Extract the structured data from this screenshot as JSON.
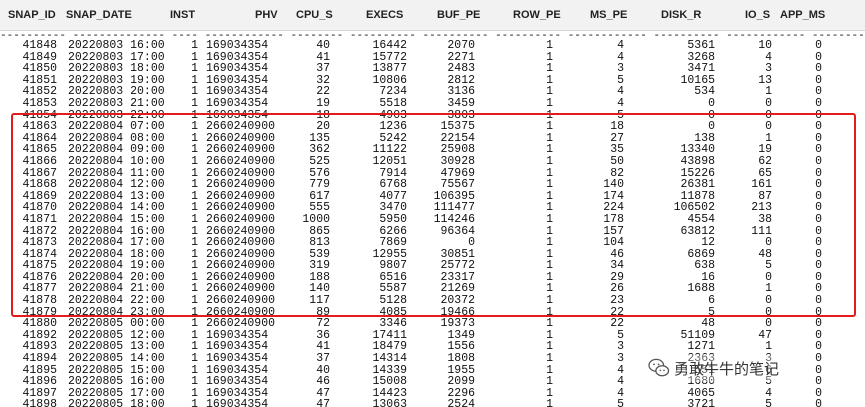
{
  "columns": [
    {
      "label": "SNAP_ID"
    },
    {
      "label": "SNAP_DATE"
    },
    {
      "label": "INST"
    },
    {
      "label": "PHV"
    },
    {
      "label": "CPU_S"
    },
    {
      "label": "EXECS"
    },
    {
      "label": "BUF_PE"
    },
    {
      "label": "ROW_PE"
    },
    {
      "label": "MS_PE"
    },
    {
      "label": "DISK_R"
    },
    {
      "label": "IO_S"
    },
    {
      "label": "APP_MS"
    }
  ],
  "separator": "---------- -------------- ---- ------------ -------- ---------- ---------- ---------- ------------ ---------- ------------ ----------",
  "rows": [
    [
      "41848",
      "20220803 16:00",
      "1",
      "169034354",
      "40",
      "16442",
      "2070",
      "1",
      "4",
      "5361",
      "10",
      "0"
    ],
    [
      "41849",
      "20220803 17:00",
      "1",
      "169034354",
      "41",
      "15772",
      "2271",
      "1",
      "4",
      "3268",
      "4",
      "0"
    ],
    [
      "41850",
      "20220803 18:00",
      "1",
      "169034354",
      "37",
      "13877",
      "2483",
      "1",
      "3",
      "3471",
      "3",
      "0"
    ],
    [
      "41851",
      "20220803 19:00",
      "1",
      "169034354",
      "32",
      "10806",
      "2812",
      "1",
      "5",
      "10165",
      "13",
      "0"
    ],
    [
      "41852",
      "20220803 20:00",
      "1",
      "169034354",
      "22",
      "7234",
      "3136",
      "1",
      "4",
      "534",
      "1",
      "0"
    ],
    [
      "41853",
      "20220803 21:00",
      "1",
      "169034354",
      "19",
      "5518",
      "3459",
      "1",
      "4",
      "0",
      "0",
      "0"
    ],
    [
      "41854",
      "20220803 22:00",
      "1",
      "169034354",
      "18",
      "4903",
      "3803",
      "1",
      "5",
      "0",
      "0",
      "0"
    ],
    [
      "41863",
      "20220804 07:00",
      "1",
      "2660240900",
      "20",
      "1236",
      "15375",
      "1",
      "18",
      "0",
      "0",
      "0"
    ],
    [
      "41864",
      "20220804 08:00",
      "1",
      "2660240900",
      "135",
      "5242",
      "22154",
      "1",
      "27",
      "138",
      "1",
      "0"
    ],
    [
      "41865",
      "20220804 09:00",
      "1",
      "2660240900",
      "362",
      "11122",
      "25908",
      "1",
      "35",
      "13340",
      "19",
      "0"
    ],
    [
      "41866",
      "20220804 10:00",
      "1",
      "2660240900",
      "525",
      "12051",
      "30928",
      "1",
      "50",
      "43898",
      "62",
      "0"
    ],
    [
      "41867",
      "20220804 11:00",
      "1",
      "2660240900",
      "576",
      "7914",
      "47969",
      "1",
      "82",
      "15226",
      "65",
      "0"
    ],
    [
      "41868",
      "20220804 12:00",
      "1",
      "2660240900",
      "779",
      "6768",
      "75567",
      "1",
      "140",
      "26381",
      "161",
      "0"
    ],
    [
      "41869",
      "20220804 13:00",
      "1",
      "2660240900",
      "617",
      "4077",
      "106395",
      "1",
      "174",
      "11878",
      "87",
      "0"
    ],
    [
      "41870",
      "20220804 14:00",
      "1",
      "2660240900",
      "555",
      "3470",
      "111477",
      "1",
      "224",
      "106502",
      "213",
      "0"
    ],
    [
      "41871",
      "20220804 15:00",
      "1",
      "2660240900",
      "1000",
      "5950",
      "114246",
      "1",
      "178",
      "4554",
      "38",
      "0"
    ],
    [
      "41872",
      "20220804 16:00",
      "1",
      "2660240900",
      "865",
      "6266",
      "96364",
      "1",
      "157",
      "63812",
      "111",
      "0"
    ],
    [
      "41873",
      "20220804 17:00",
      "1",
      "2660240900",
      "813",
      "7869",
      "0",
      "1",
      "104",
      "12",
      "0",
      "0"
    ],
    [
      "41874",
      "20220804 18:00",
      "1",
      "2660240900",
      "539",
      "12955",
      "30851",
      "1",
      "46",
      "6869",
      "48",
      "0"
    ],
    [
      "41875",
      "20220804 19:00",
      "1",
      "2660240900",
      "319",
      "9807",
      "25772",
      "1",
      "34",
      "638",
      "5",
      "0"
    ],
    [
      "41876",
      "20220804 20:00",
      "1",
      "2660240900",
      "188",
      "6516",
      "23317",
      "1",
      "29",
      "16",
      "0",
      "0"
    ],
    [
      "41877",
      "20220804 21:00",
      "1",
      "2660240900",
      "140",
      "5587",
      "21269",
      "1",
      "26",
      "1688",
      "1",
      "0"
    ],
    [
      "41878",
      "20220804 22:00",
      "1",
      "2660240900",
      "117",
      "5128",
      "20372",
      "1",
      "23",
      "6",
      "0",
      "0"
    ],
    [
      "41879",
      "20220804 23:00",
      "1",
      "2660240900",
      "89",
      "4085",
      "19466",
      "1",
      "22",
      "5",
      "0",
      "0"
    ],
    [
      "41880",
      "20220805 00:00",
      "1",
      "2660240900",
      "72",
      "3346",
      "19373",
      "1",
      "22",
      "48",
      "0",
      "0"
    ],
    [
      "41892",
      "20220805 12:00",
      "1",
      "169034354",
      "36",
      "17411",
      "1349",
      "1",
      "5",
      "51109",
      "47",
      "0"
    ],
    [
      "41893",
      "20220805 13:00",
      "1",
      "169034354",
      "41",
      "18479",
      "1556",
      "1",
      "3",
      "1271",
      "1",
      "0"
    ],
    [
      "41894",
      "20220805 14:00",
      "1",
      "169034354",
      "37",
      "14314",
      "1808",
      "1",
      "3",
      "2363",
      "3",
      "0"
    ],
    [
      "41895",
      "20220805 15:00",
      "1",
      "169034354",
      "40",
      "14339",
      "1955",
      "1",
      "4",
      "551",
      "6",
      "0"
    ],
    [
      "41896",
      "20220805 16:00",
      "1",
      "169034354",
      "46",
      "15008",
      "2099",
      "1",
      "4",
      "1680",
      "5",
      "0"
    ],
    [
      "41897",
      "20220805 17:00",
      "1",
      "169034354",
      "47",
      "14423",
      "2296",
      "1",
      "4",
      "4065",
      "4",
      "0"
    ],
    [
      "41898",
      "20220805 18:00",
      "1",
      "169034354",
      "47",
      "13063",
      "2524",
      "1",
      "5",
      "3721",
      "5",
      "0"
    ]
  ],
  "watermark": {
    "text": "勇敢牛牛的笔记",
    "icon": "wechat-icon"
  },
  "colors": {
    "highlight_border": "#e31b1b",
    "header_bg": "#f2f2f2"
  }
}
